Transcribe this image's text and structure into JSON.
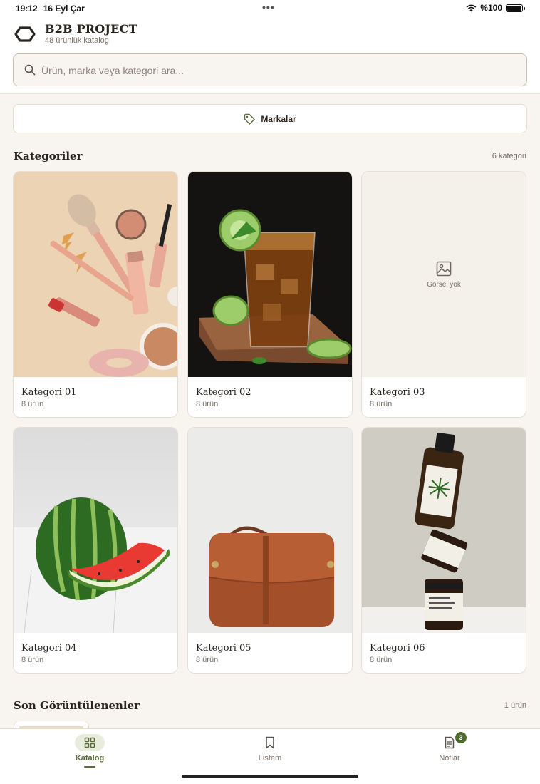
{
  "status_bar": {
    "time": "19:12",
    "date": "16 Eyl Çar",
    "battery": "%100"
  },
  "header": {
    "title": "B2B PROJECT",
    "subtitle": "48 ürünlük katalog"
  },
  "search": {
    "placeholder": "Ürün, marka veya kategori ara..."
  },
  "brands_button": {
    "label": "Markalar",
    "icon": "tag-icon"
  },
  "categories_section": {
    "title": "Kategoriler",
    "count": "6 kategori",
    "items": [
      {
        "name": "Kategori 01",
        "count": "8 ürün",
        "image": "makeup-products"
      },
      {
        "name": "Kategori 02",
        "count": "8 ürün",
        "image": "iced-drink"
      },
      {
        "name": "Kategori 03",
        "count": "8 ürün",
        "image": "none",
        "no_image_text": "Görsel yok"
      },
      {
        "name": "Kategori 04",
        "count": "8 ürün",
        "image": "watermelon"
      },
      {
        "name": "Kategori 05",
        "count": "8 ürün",
        "image": "leather-bag"
      },
      {
        "name": "Kategori 06",
        "count": "8 ürün",
        "image": "supplement-jars"
      }
    ]
  },
  "recent_section": {
    "title": "Son Görüntülenenler",
    "count": "1 ürün"
  },
  "bottom_nav": {
    "items": [
      {
        "label": "Katalog",
        "icon": "grid-icon",
        "active": true
      },
      {
        "label": "Listem",
        "icon": "bookmark-icon",
        "active": false
      },
      {
        "label": "Notlar",
        "icon": "notes-icon",
        "active": false,
        "badge": "3"
      }
    ]
  },
  "colors": {
    "accent": "#5a6b3a",
    "background": "#f8f5f0",
    "badge": "#4f6b2c"
  }
}
